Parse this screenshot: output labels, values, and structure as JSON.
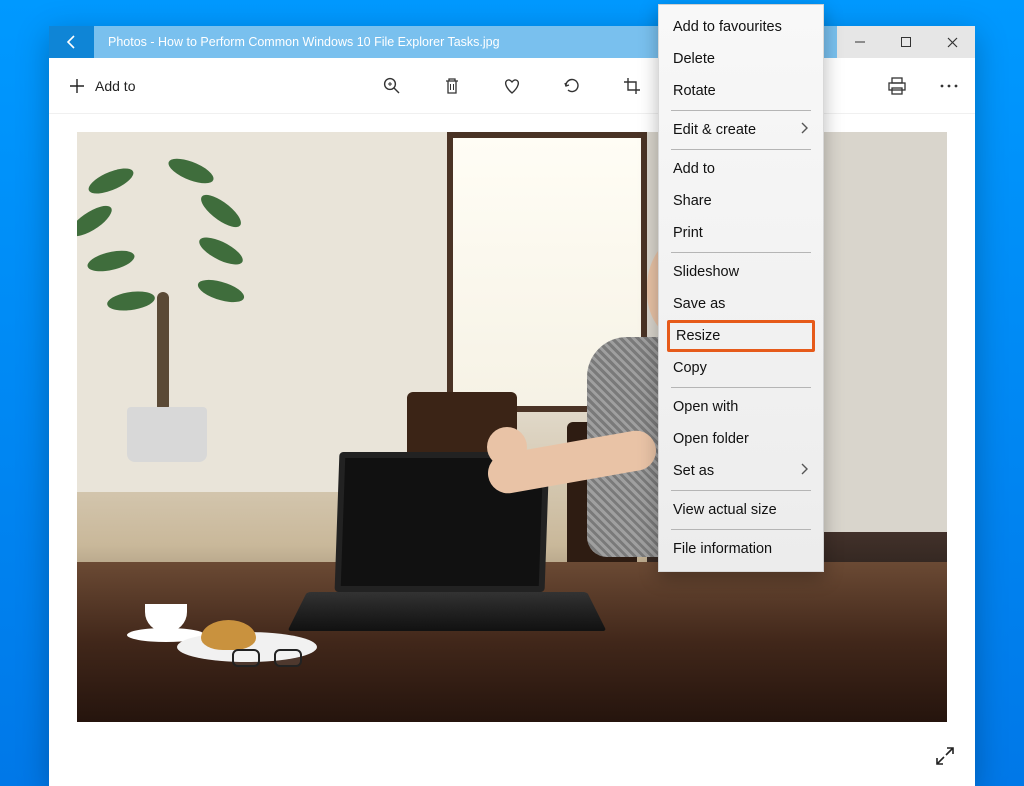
{
  "titlebar": {
    "app": "Photos",
    "separator": " - ",
    "filename": "How to Perform Common Windows 10 File Explorer Tasks.jpg"
  },
  "toolbar": {
    "add_to_label": "Add to"
  },
  "context_menu": {
    "groups": [
      {
        "items": [
          {
            "label": "Add to favourites",
            "submenu": false
          },
          {
            "label": "Delete",
            "submenu": false
          },
          {
            "label": "Rotate",
            "submenu": false
          }
        ]
      },
      {
        "items": [
          {
            "label": "Edit & create",
            "submenu": true
          }
        ]
      },
      {
        "items": [
          {
            "label": "Add to",
            "submenu": false
          },
          {
            "label": "Share",
            "submenu": false
          },
          {
            "label": "Print",
            "submenu": false
          }
        ]
      },
      {
        "items": [
          {
            "label": "Slideshow",
            "submenu": false
          },
          {
            "label": "Save as",
            "submenu": false
          },
          {
            "label": "Resize",
            "submenu": false,
            "highlighted": true
          },
          {
            "label": "Copy",
            "submenu": false
          }
        ]
      },
      {
        "items": [
          {
            "label": "Open with",
            "submenu": false
          },
          {
            "label": "Open folder",
            "submenu": false
          },
          {
            "label": "Set as",
            "submenu": true
          }
        ]
      },
      {
        "items": [
          {
            "label": "View actual size",
            "submenu": false
          }
        ]
      },
      {
        "items": [
          {
            "label": "File information",
            "submenu": false
          }
        ]
      }
    ]
  }
}
